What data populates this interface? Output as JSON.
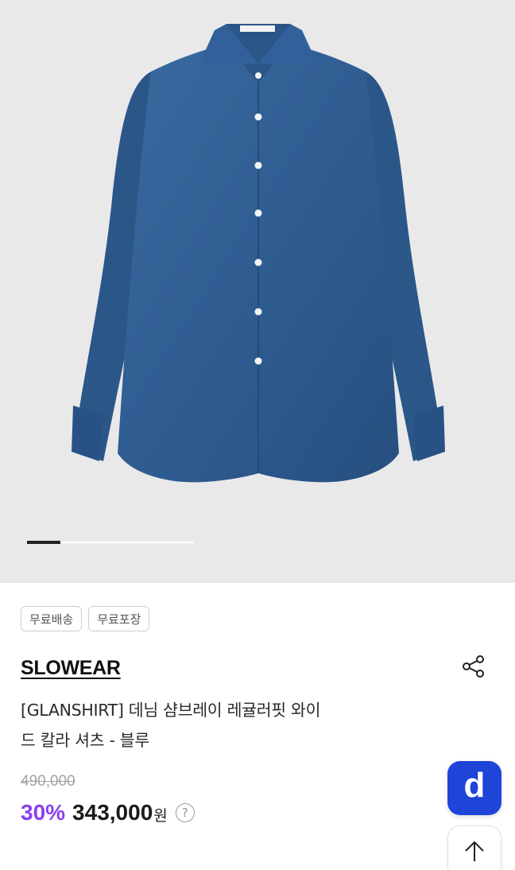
{
  "gallery": {
    "image": "blue-denim-shirt",
    "slide_index": 1,
    "colors": {
      "background": "#e9e9ea",
      "shirt": "#2f5d92"
    }
  },
  "badges": [
    "무료배송",
    "무료포장"
  ],
  "brand": "SLOWEAR",
  "product": {
    "title_line1": "[GLANSHIRT] 데님 샴브레이 레귤러핏 와이",
    "title_line2": "드 칼라 셔츠 - 블루"
  },
  "price": {
    "original": "490,000",
    "discount": "30%",
    "sale": "343,000",
    "currency": "원",
    "help_symbol": "?"
  },
  "actions": {
    "share_icon": "share-icon",
    "d_button_label": "d",
    "scroll_top_icon": "arrow-up-icon"
  },
  "colors": {
    "accent_discount": "#8a3ff1",
    "d_button": "#1f44d8"
  }
}
